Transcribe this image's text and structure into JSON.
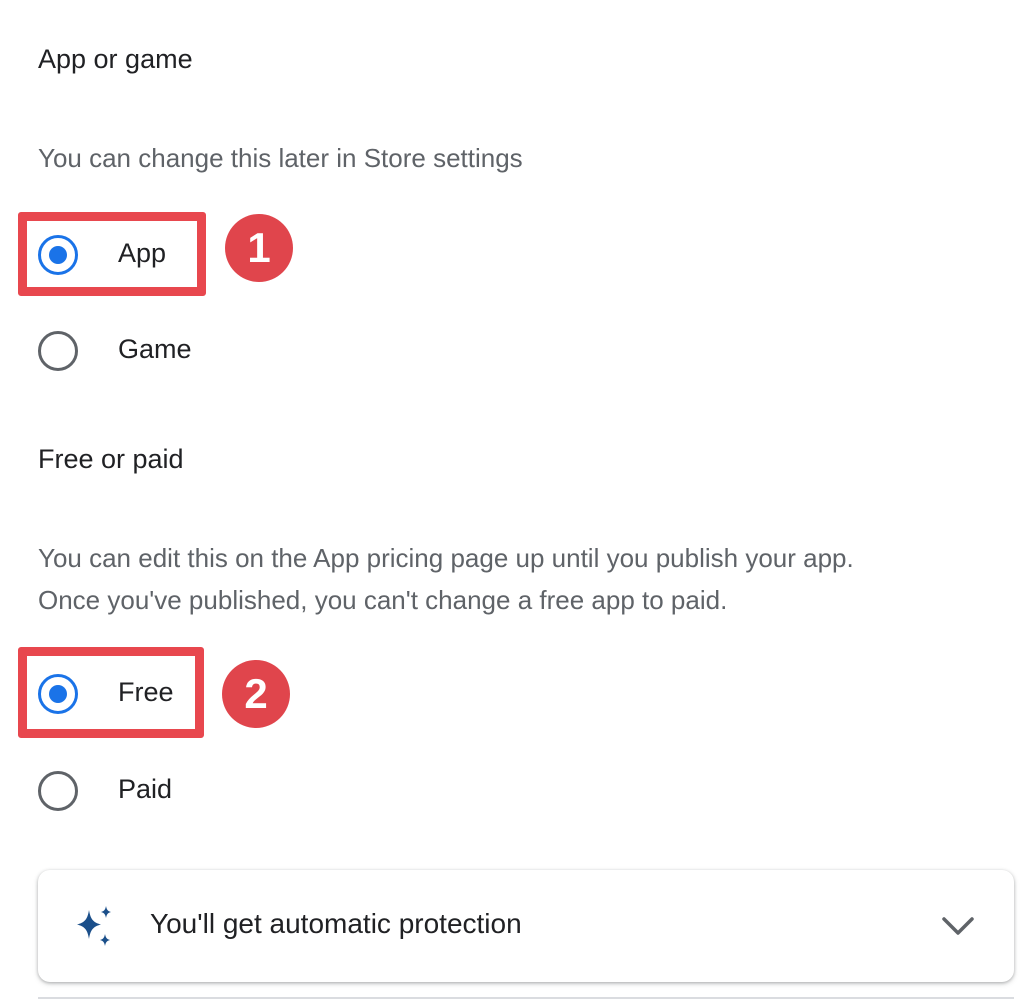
{
  "app_type": {
    "title": "App or game",
    "description": "You can change this later in Store settings",
    "options": [
      {
        "label": "App",
        "selected": true
      },
      {
        "label": "Game",
        "selected": false
      }
    ]
  },
  "pricing": {
    "title": "Free or paid",
    "description_line1": "You can edit this on the App pricing page up until you publish your app.",
    "description_line2": "Once you've published, you can't change a free app to paid.",
    "options": [
      {
        "label": "Free",
        "selected": true
      },
      {
        "label": "Paid",
        "selected": false
      }
    ]
  },
  "annotations": {
    "step1": "1",
    "step2": "2",
    "highlight_color": "#e8474e",
    "badge_color": "#e0454c"
  },
  "protection_card": {
    "label": "You'll get automatic protection",
    "icon": "sparkle-icon",
    "expand_icon": "chevron-down-icon"
  },
  "colors": {
    "accent": "#1a73e8",
    "sparkle": "#1b4f8a"
  }
}
